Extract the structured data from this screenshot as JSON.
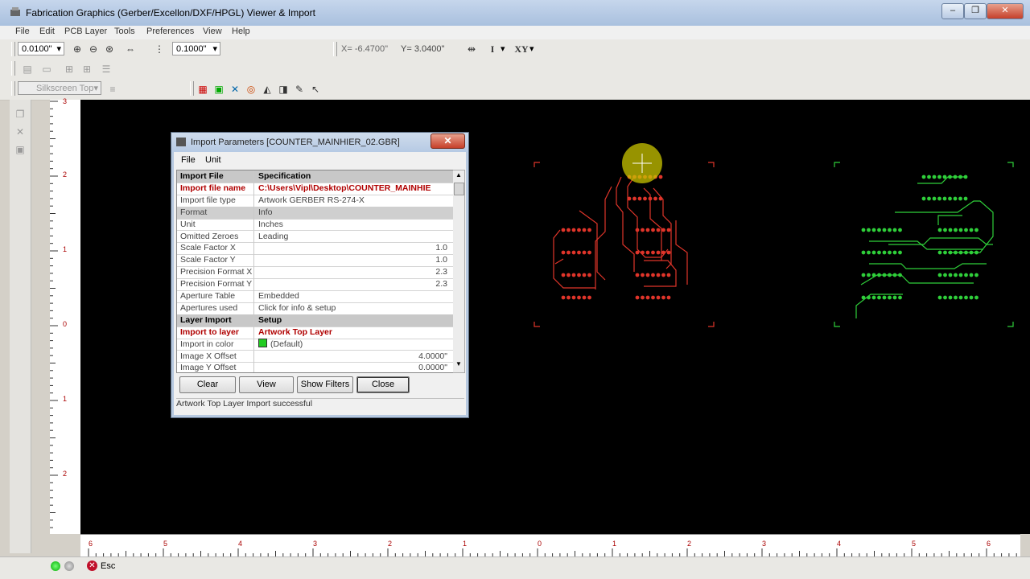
{
  "window": {
    "title": "Fabrication Graphics (Gerber/Excellon/DXF/HPGL) Viewer & Import",
    "minimize": "–",
    "restore": "❐",
    "close": "✕"
  },
  "menubar": [
    "File",
    "Edit",
    "PCB Layer",
    "Tools",
    "Preferences",
    "View",
    "Help"
  ],
  "toolbar": {
    "grid_size": "0.0100\"",
    "snap_size": "0.1000\"",
    "coord_x": "X= -6.4700\"",
    "coord_y": "Y= 3.0400\"",
    "mode_i": "I",
    "mode_xy": "XY",
    "layer_select": "Silkscreen Top"
  },
  "dialog": {
    "title": "Import Parameters [COUNTER_MAINHIER_02.GBR]",
    "close_label": "✕",
    "menu": [
      "File",
      "Unit"
    ],
    "rows": [
      {
        "label": "Import File",
        "value": "Specification",
        "style": "hdr"
      },
      {
        "label": "Import file name",
        "value": "C:\\Users\\Vipl\\Desktop\\COUNTER_MAINHIE",
        "style": "red"
      },
      {
        "label": "Import file type",
        "value": "Artwork GERBER RS-274-X",
        "style": ""
      },
      {
        "label": "Format",
        "value": "Info",
        "style": "grey"
      },
      {
        "label": "Unit",
        "value": "Inches",
        "style": ""
      },
      {
        "label": "Omitted Zeroes",
        "value": "Leading",
        "style": ""
      },
      {
        "label": "Scale Factor X",
        "value": "1.0",
        "style": "num"
      },
      {
        "label": "Scale Factor Y",
        "value": "1.0",
        "style": "num"
      },
      {
        "label": "Precision Format X",
        "value": "2.3",
        "style": "num"
      },
      {
        "label": "Precision Format Y",
        "value": "2.3",
        "style": "num"
      },
      {
        "label": "Aperture Table",
        "value": "Embedded",
        "style": ""
      },
      {
        "label": "Apertures used",
        "value": "Click for info & setup",
        "style": ""
      },
      {
        "label": "Layer Import",
        "value": "Setup",
        "style": "hdr"
      },
      {
        "label": "Import to layer",
        "value": "Artwork Top Layer",
        "style": "red"
      },
      {
        "label": "Import in color",
        "value": "(Default)",
        "style": "color"
      },
      {
        "label": "Image X Offset",
        "value": "4.0000\"",
        "style": "num"
      },
      {
        "label": "Image Y Offset",
        "value": "0.0000\"",
        "style": "num"
      }
    ],
    "buttons": {
      "clear": "Clear",
      "view": "View",
      "show_filters": "Show Filters",
      "close": "Close"
    },
    "status": "Artwork Top Layer Import successful"
  },
  "vruler_labels": [
    "3",
    "2",
    "1",
    "0",
    "1",
    "2"
  ],
  "hruler_labels": [
    "6",
    "5",
    "4",
    "3",
    "2",
    "1",
    "0",
    "1",
    "2",
    "3",
    "4",
    "5",
    "6"
  ],
  "statusbar": {
    "esc_label": "Esc"
  },
  "colors": {
    "top_layer": "#e0352a",
    "bottom_layer": "#2fcf3a",
    "import_color": "#22cc22"
  }
}
